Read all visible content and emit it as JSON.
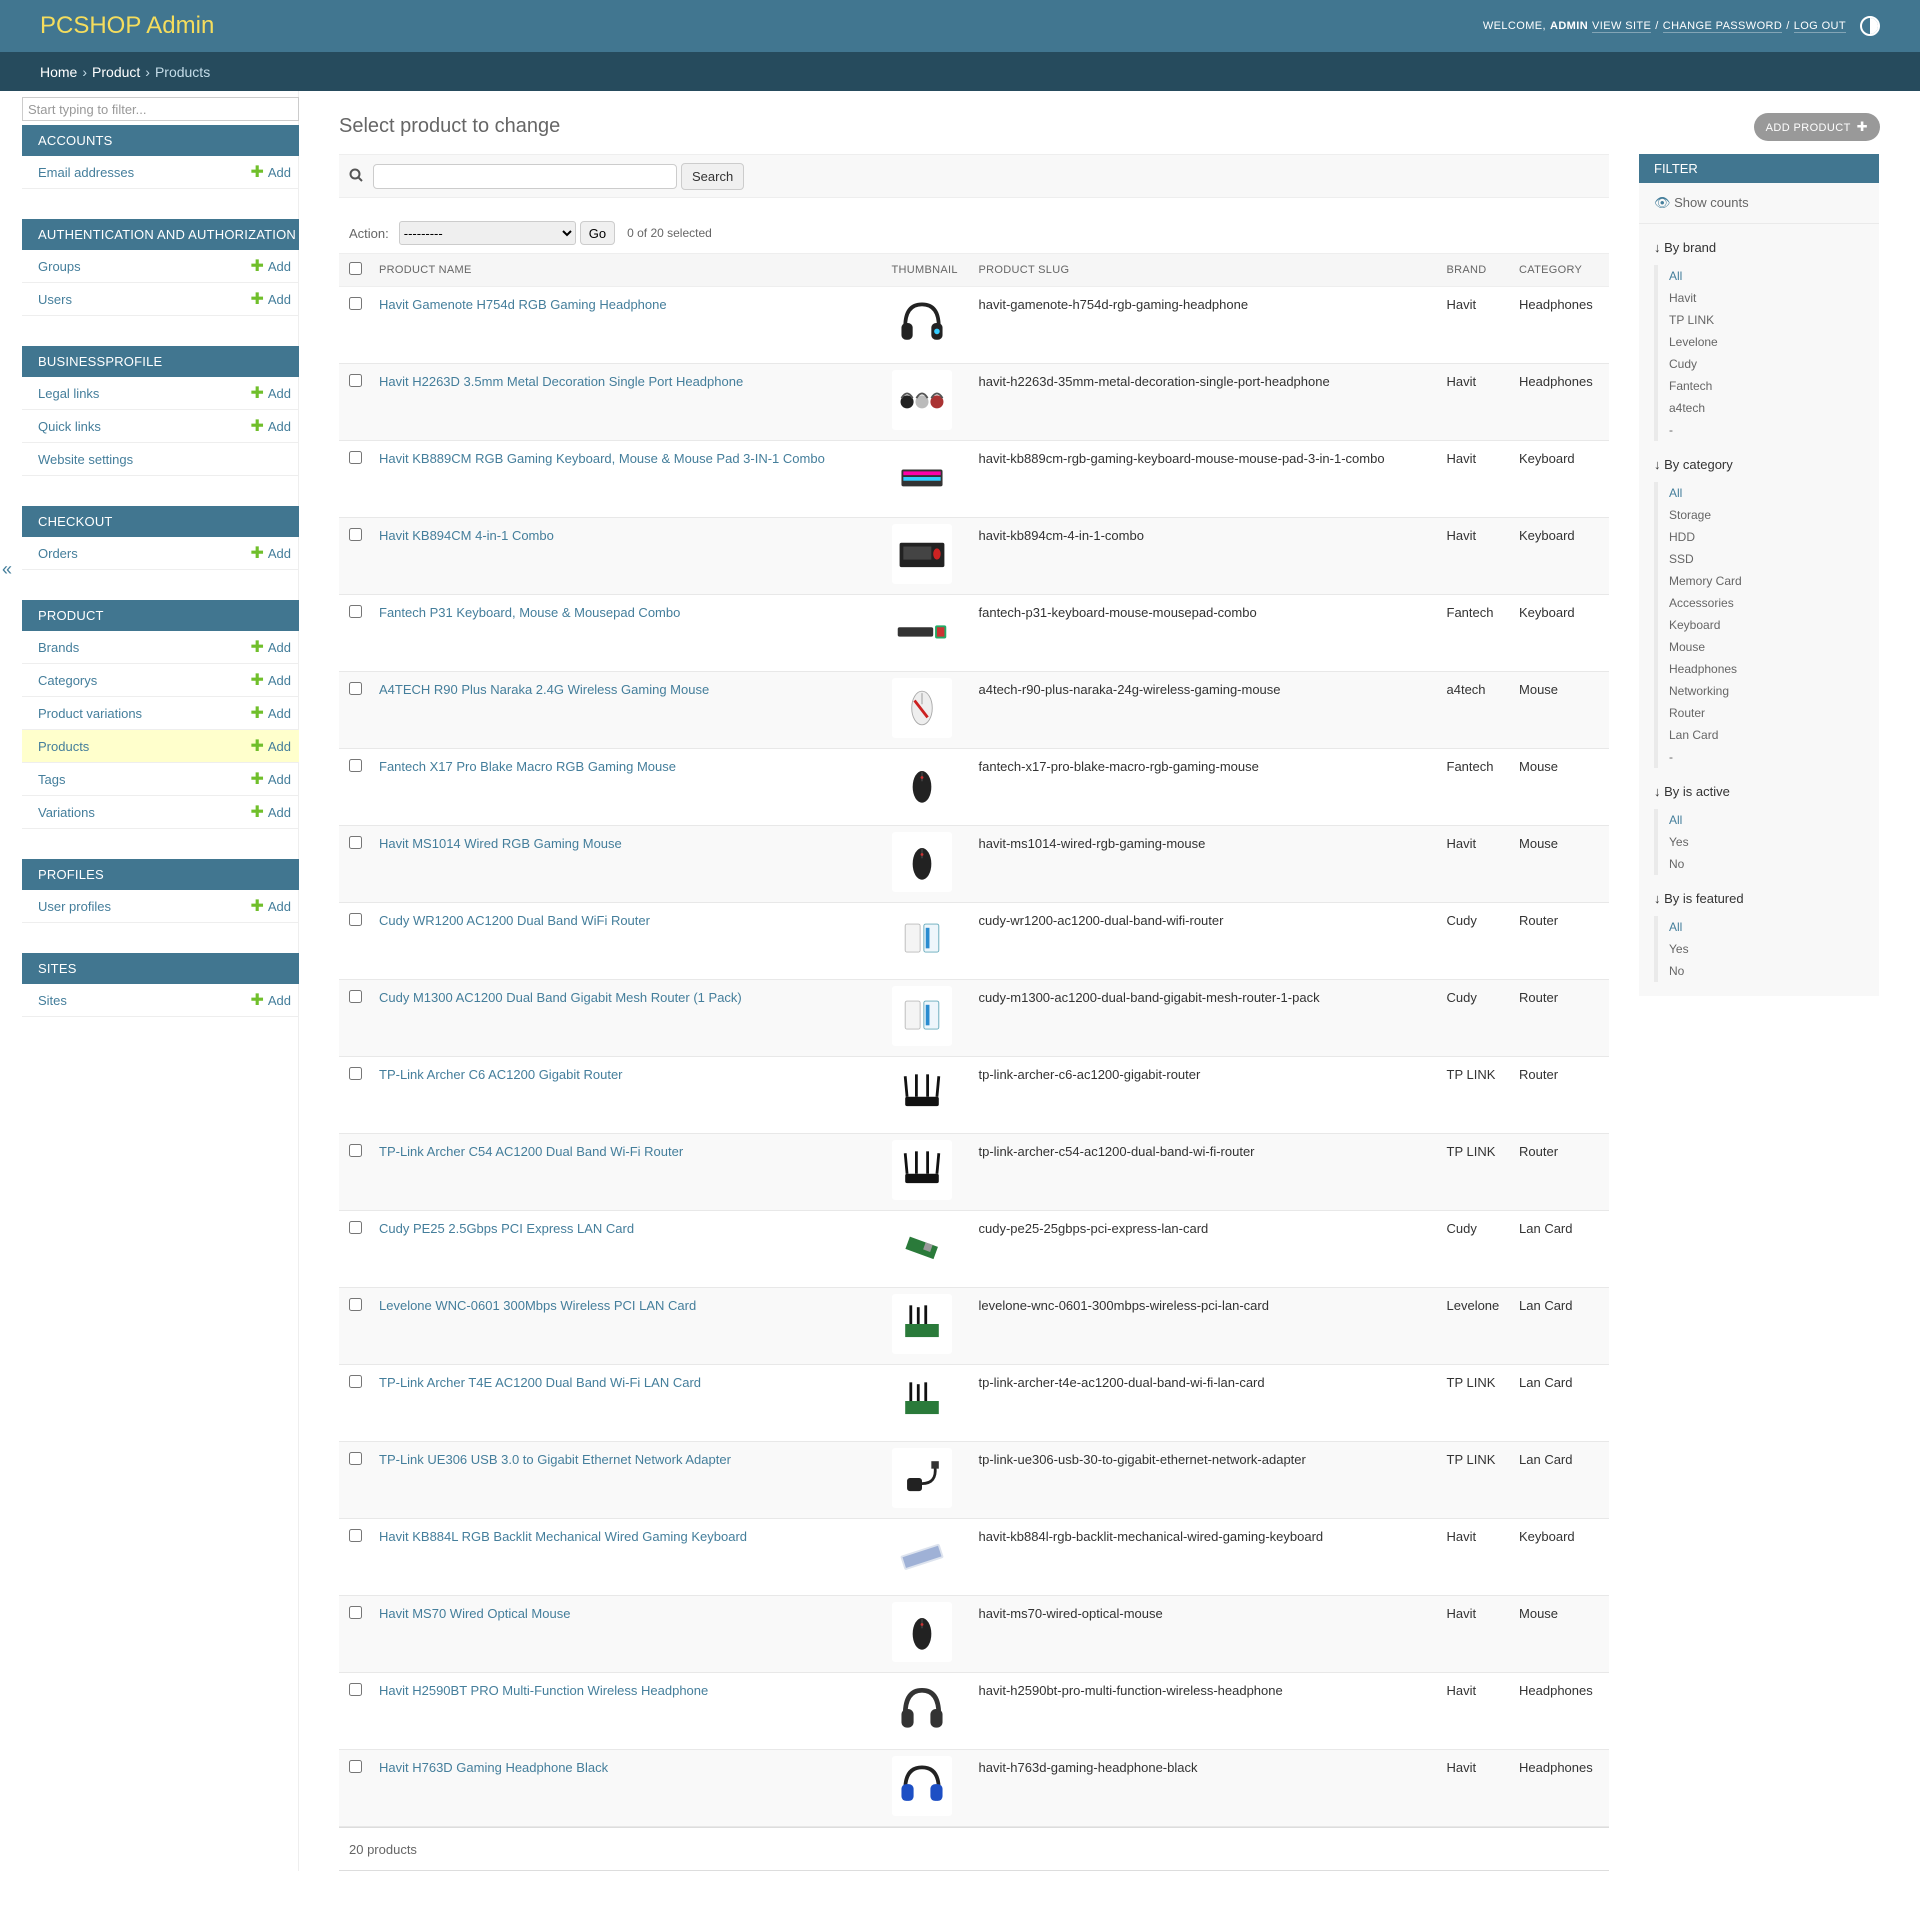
{
  "header": {
    "brand": "PCSHOP Admin",
    "welcome": "WELCOME,",
    "username": "ADMIN",
    "view_site": "VIEW SITE",
    "change_password": "CHANGE PASSWORD",
    "log_out": "LOG OUT",
    "slash": "/"
  },
  "breadcrumbs": {
    "home": "Home",
    "app": "Product",
    "current": "Products",
    "sep": "›"
  },
  "sidebar": {
    "filter_placeholder": "Start typing to filter...",
    "add_label": "Add",
    "collapse_glyph": "«",
    "modules": [
      {
        "caption": "ACCOUNTS",
        "models": [
          {
            "label": "Email addresses",
            "add": true
          }
        ]
      },
      {
        "caption": "AUTHENTICATION AND AUTHORIZATION",
        "models": [
          {
            "label": "Groups",
            "add": true
          },
          {
            "label": "Users",
            "add": true
          }
        ]
      },
      {
        "caption": "BUSINESSPROFILE",
        "models": [
          {
            "label": "Legal links",
            "add": true
          },
          {
            "label": "Quick links",
            "add": true
          },
          {
            "label": "Website settings",
            "add": false
          }
        ]
      },
      {
        "caption": "CHECKOUT",
        "models": [
          {
            "label": "Orders",
            "add": true
          }
        ]
      },
      {
        "caption": "PRODUCT",
        "models": [
          {
            "label": "Brands",
            "add": true
          },
          {
            "label": "Categorys",
            "add": true
          },
          {
            "label": "Product variations",
            "add": true
          },
          {
            "label": "Products",
            "add": true,
            "current": true
          },
          {
            "label": "Tags",
            "add": true
          },
          {
            "label": "Variations",
            "add": true
          }
        ]
      },
      {
        "caption": "PROFILES",
        "models": [
          {
            "label": "User profiles",
            "add": true
          }
        ]
      },
      {
        "caption": "SITES",
        "models": [
          {
            "label": "Sites",
            "add": true
          }
        ]
      }
    ]
  },
  "content": {
    "title": "Select product to change",
    "add_button": "ADD PRODUCT",
    "search_button": "Search",
    "action_label": "Action:",
    "action_selected": "---------",
    "go_button": "Go",
    "selected_count": "0 of 20 selected",
    "columns": [
      "PRODUCT NAME",
      "THUMBNAIL",
      "PRODUCT SLUG",
      "BRAND",
      "CATEGORY"
    ],
    "products": [
      {
        "name": "Havit Gamenote H754d RGB Gaming Headphone",
        "slug": "havit-gamenote-h754d-rgb-gaming-headphone",
        "brand": "Havit",
        "category": "Headphones",
        "thumb": "headphone-rgb"
      },
      {
        "name": "Havit H2263D 3.5mm Metal Decoration Single Port Headphone",
        "slug": "havit-h2263d-35mm-metal-decoration-single-port-headphone",
        "brand": "Havit",
        "category": "Headphones",
        "thumb": "headphone-trio"
      },
      {
        "name": "Havit KB889CM RGB Gaming Keyboard, Mouse & Mouse Pad 3-IN-1 Combo",
        "slug": "havit-kb889cm-rgb-gaming-keyboard-mouse-mouse-pad-3-in-1-combo",
        "brand": "Havit",
        "category": "Keyboard",
        "thumb": "keyboard-combo"
      },
      {
        "name": "Havit KB894CM 4-in-1 Combo",
        "slug": "havit-kb894cm-4-in-1-combo",
        "brand": "Havit",
        "category": "Keyboard",
        "thumb": "keyboard-combo-red"
      },
      {
        "name": "Fantech P31 Keyboard, Mouse & Mousepad Combo",
        "slug": "fantech-p31-keyboard-mouse-mousepad-combo",
        "brand": "Fantech",
        "category": "Keyboard",
        "thumb": "keyboard-flat"
      },
      {
        "name": "A4TECH R90 Plus Naraka 2.4G Wireless Gaming Mouse",
        "slug": "a4tech-r90-plus-naraka-24g-wireless-gaming-mouse",
        "brand": "a4tech",
        "category": "Mouse",
        "thumb": "mouse-white"
      },
      {
        "name": "Fantech X17 Pro Blake Macro RGB Gaming Mouse",
        "slug": "fantech-x17-pro-blake-macro-rgb-gaming-mouse",
        "brand": "Fantech",
        "category": "Mouse",
        "thumb": "mouse-black"
      },
      {
        "name": "Havit MS1014 Wired RGB Gaming Mouse",
        "slug": "havit-ms1014-wired-rgb-gaming-mouse",
        "brand": "Havit",
        "category": "Mouse",
        "thumb": "mouse-black"
      },
      {
        "name": "Cudy WR1200 AC1200 Dual Band WiFi Router",
        "slug": "cudy-wr1200-ac1200-dual-band-wifi-router",
        "brand": "Cudy",
        "category": "Router",
        "thumb": "router-white"
      },
      {
        "name": "Cudy M1300 AC1200 Dual Band Gigabit Mesh Router (1 Pack)",
        "slug": "cudy-m1300-ac1200-dual-band-gigabit-mesh-router-1-pack",
        "brand": "Cudy",
        "category": "Router",
        "thumb": "router-white"
      },
      {
        "name": "TP-Link Archer C6 AC1200 Gigabit Router",
        "slug": "tp-link-archer-c6-ac1200-gigabit-router",
        "brand": "TP LINK",
        "category": "Router",
        "thumb": "router-black"
      },
      {
        "name": "TP-Link Archer C54 AC1200 Dual Band Wi-Fi Router",
        "slug": "tp-link-archer-c54-ac1200-dual-band-wi-fi-router",
        "brand": "TP LINK",
        "category": "Router",
        "thumb": "router-black"
      },
      {
        "name": "Cudy PE25 2.5Gbps PCI Express LAN Card",
        "slug": "cudy-pe25-25gbps-pci-express-lan-card",
        "brand": "Cudy",
        "category": "Lan Card",
        "thumb": "pci-card"
      },
      {
        "name": "Levelone WNC-0601 300Mbps Wireless PCI LAN Card",
        "slug": "levelone-wnc-0601-300mbps-wireless-pci-lan-card",
        "brand": "Levelone",
        "category": "Lan Card",
        "thumb": "pci-antenna"
      },
      {
        "name": "TP-Link Archer T4E AC1200 Dual Band Wi-Fi LAN Card",
        "slug": "tp-link-archer-t4e-ac1200-dual-band-wi-fi-lan-card",
        "brand": "TP LINK",
        "category": "Lan Card",
        "thumb": "pci-antenna"
      },
      {
        "name": "TP-Link UE306 USB 3.0 to Gigabit Ethernet Network Adapter",
        "slug": "tp-link-ue306-usb-30-to-gigabit-ethernet-network-adapter",
        "brand": "TP LINK",
        "category": "Lan Card",
        "thumb": "usb-adapter"
      },
      {
        "name": "Havit KB884L RGB Backlit Mechanical Wired Gaming Keyboard",
        "slug": "havit-kb884l-rgb-backlit-mechanical-wired-gaming-keyboard",
        "brand": "Havit",
        "category": "Keyboard",
        "thumb": "keyboard-white"
      },
      {
        "name": "Havit MS70 Wired Optical Mouse",
        "slug": "havit-ms70-wired-optical-mouse",
        "brand": "Havit",
        "category": "Mouse",
        "thumb": "mouse-black"
      },
      {
        "name": "Havit H2590BT PRO Multi-Function Wireless Headphone",
        "slug": "havit-h2590bt-pro-multi-function-wireless-headphone",
        "brand": "Havit",
        "category": "Headphones",
        "thumb": "headphone-black"
      },
      {
        "name": "Havit H763D Gaming Headphone Black",
        "slug": "havit-h763d-gaming-headphone-black",
        "brand": "Havit",
        "category": "Headphones",
        "thumb": "headphone-blue"
      }
    ],
    "paginator": "20 products"
  },
  "filter": {
    "title": "FILTER",
    "show_counts": "Show counts",
    "groups": [
      {
        "title": "↓ By brand",
        "options": [
          "All",
          "Havit",
          "TP LINK",
          "Levelone",
          "Cudy",
          "Fantech",
          "a4tech",
          "-"
        ]
      },
      {
        "title": "↓ By category",
        "options": [
          "All",
          "Storage",
          "HDD",
          "SSD",
          "Memory Card",
          "Accessories",
          "Keyboard",
          "Mouse",
          "Headphones",
          "Networking",
          "Router",
          "Lan Card",
          "-"
        ]
      },
      {
        "title": "↓ By is active",
        "options": [
          "All",
          "Yes",
          "No"
        ]
      },
      {
        "title": "↓ By is featured",
        "options": [
          "All",
          "Yes",
          "No"
        ]
      }
    ]
  },
  "colors": {
    "header": "#417690",
    "breadcrumbs": "#264b5d",
    "brand": "#f5dd5d",
    "link": "#447e9b",
    "add_plus": "#70bf2b",
    "current_row": "#ffffcc"
  }
}
